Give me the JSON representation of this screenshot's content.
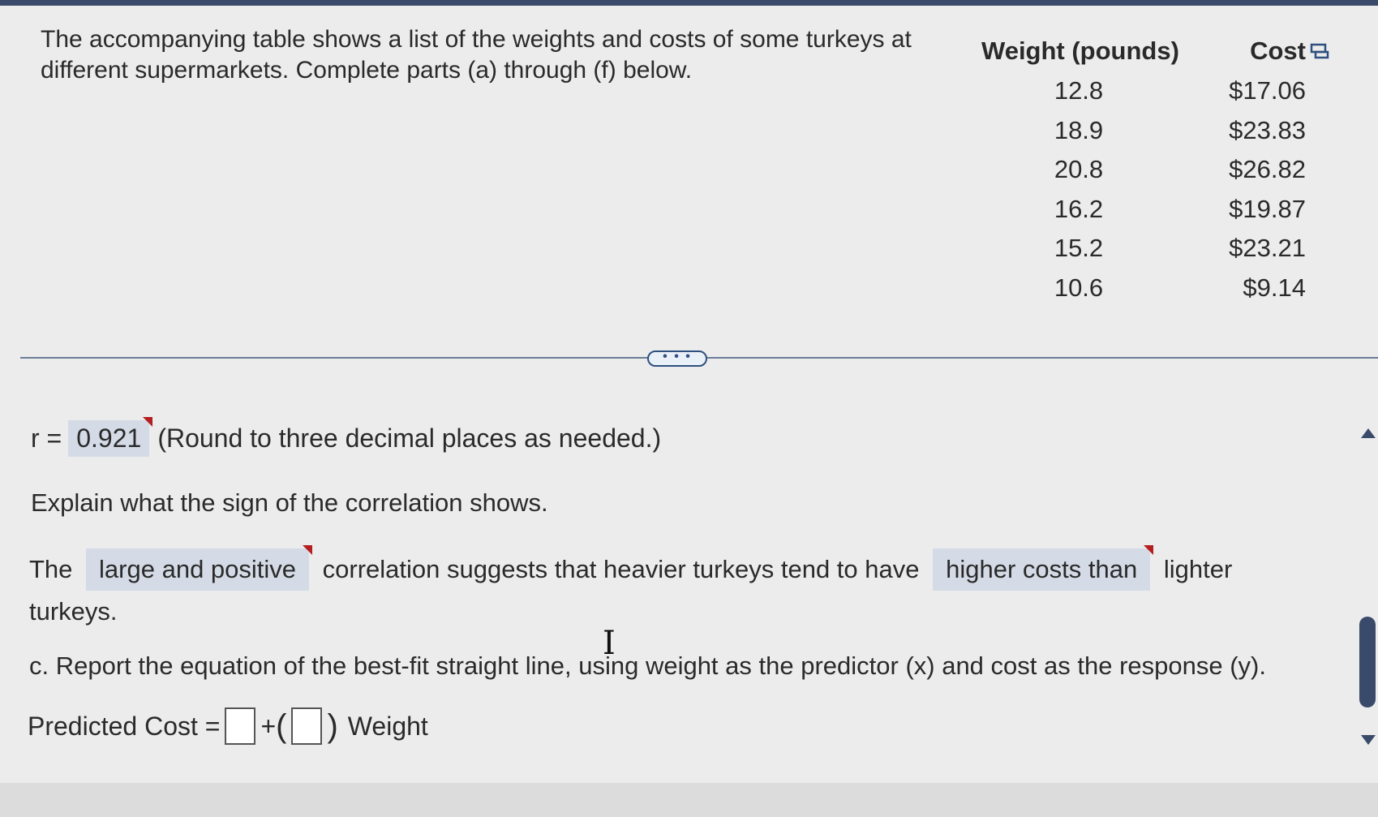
{
  "intro": "The accompanying table shows a list of the weights and costs of some turkeys at different supermarkets. Complete parts (a) through (f) below.",
  "table": {
    "headers": [
      "Weight (pounds)",
      "Cost"
    ],
    "rows": [
      [
        "12.8",
        "$17.06"
      ],
      [
        "18.9",
        "$23.83"
      ],
      [
        "20.8",
        "$26.82"
      ],
      [
        "16.2",
        "$19.87"
      ],
      [
        "15.2",
        "$23.21"
      ],
      [
        "10.6",
        "$9.14"
      ]
    ]
  },
  "more_button": "• • •",
  "r_line": {
    "label": "r =",
    "value": "0.921",
    "note": "(Round to three decimal places as needed.)"
  },
  "explain_prompt": "Explain what the sign of the correlation shows.",
  "sentence": {
    "part1": "The",
    "dropdown1": "large and positive",
    "part2": "correlation suggests that heavier turkeys tend to have",
    "dropdown2": "higher costs than",
    "part3": "lighter turkeys."
  },
  "part_c": "c. Report the equation of the best-fit straight line, using weight as the predictor (x) and cost as the response (y).",
  "predicted": {
    "label": "Predicted Cost =",
    "plus": "+",
    "weight_label": "Weight"
  }
}
